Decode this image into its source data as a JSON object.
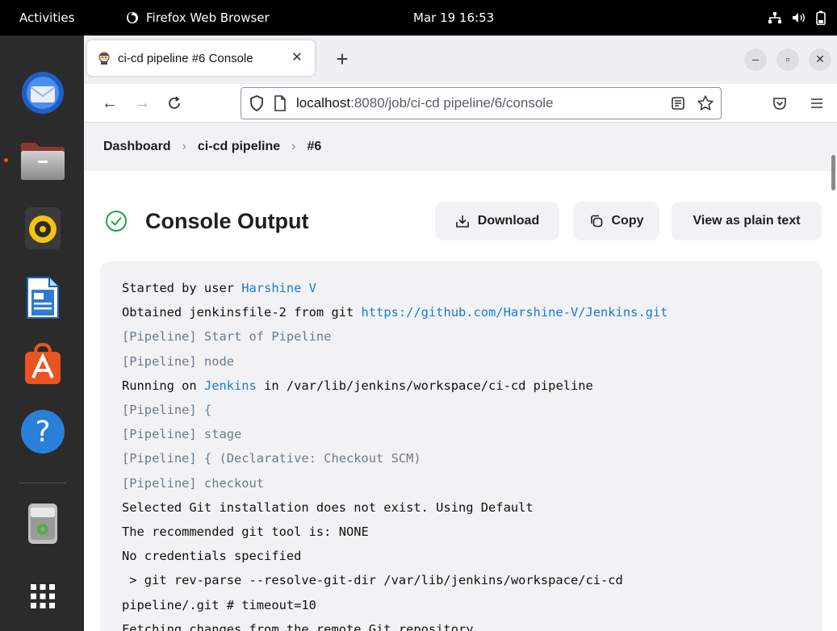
{
  "topbar": {
    "activities": "Activities",
    "app_name": "Firefox Web Browser",
    "clock": "Mar 19  16:53"
  },
  "dock": {
    "apps": [
      "thunderbird-icon",
      "files-icon",
      "rhythmbox-icon",
      "libreoffice-writer-icon",
      "software-center-icon",
      "help-icon",
      "trash-icon",
      "show-apps-icon"
    ]
  },
  "browser": {
    "tab_title": "ci-cd pipeline #6 Console",
    "url_host": "localhost",
    "url_rest": ":8080/job/ci-cd pipeline/6/console"
  },
  "breadcrumbs": [
    "Dashboard",
    "ci-cd pipeline",
    "#6"
  ],
  "page": {
    "title": "Console Output",
    "actions": {
      "download": "Download",
      "copy": "Copy",
      "plain": "View as plain text"
    }
  },
  "console": {
    "lines": [
      [
        {
          "t": "Started by user "
        },
        {
          "t": "Harshine V",
          "k": "link"
        }
      ],
      [
        {
          "t": "Obtained jenkinsfile-2 from git "
        },
        {
          "t": "https://github.com/Harshine-V/Jenkins.git",
          "k": "link"
        }
      ],
      [
        {
          "t": "[Pipeline] Start of Pipeline",
          "k": "pipeline"
        }
      ],
      [
        {
          "t": "[Pipeline] node",
          "k": "pipeline"
        }
      ],
      [
        {
          "t": "Running on "
        },
        {
          "t": "Jenkins",
          "k": "link"
        },
        {
          "t": " in /var/lib/jenkins/workspace/ci-cd pipeline"
        }
      ],
      [
        {
          "t": "[Pipeline] {",
          "k": "pipeline"
        }
      ],
      [
        {
          "t": "[Pipeline] stage",
          "k": "pipeline"
        }
      ],
      [
        {
          "t": "[Pipeline] { (Declarative: Checkout SCM)",
          "k": "pipeline"
        }
      ],
      [
        {
          "t": "[Pipeline] checkout",
          "k": "pipeline"
        }
      ],
      [
        {
          "t": "Selected Git installation does not exist. Using Default"
        }
      ],
      [
        {
          "t": "The recommended git tool is: NONE"
        }
      ],
      [
        {
          "t": "No credentials specified"
        }
      ],
      [
        {
          "t": " > git rev-parse --resolve-git-dir /var/lib/jenkins/workspace/ci-cd"
        }
      ],
      [
        {
          "t": "pipeline/.git # timeout=10"
        }
      ],
      [
        {
          "t": "Fetching changes from the remote Git repository"
        }
      ]
    ]
  }
}
